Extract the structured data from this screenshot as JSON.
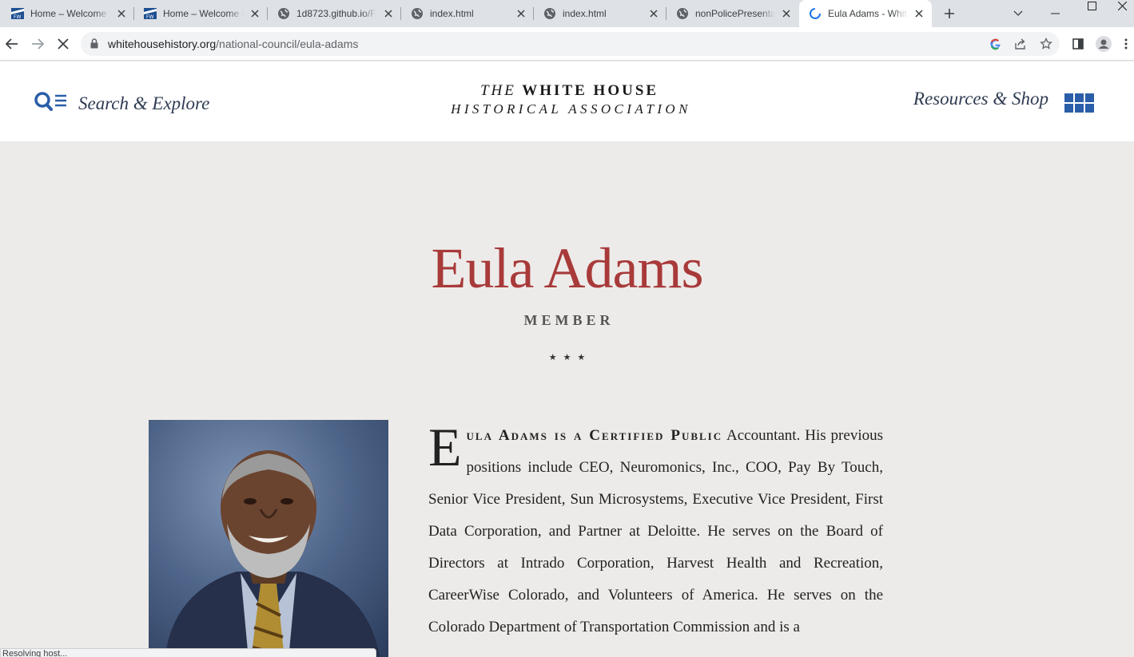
{
  "browser": {
    "tabs": [
      {
        "title": "Home – Welcome to",
        "favicon": "fw-favicon"
      },
      {
        "title": "Home – Welcome to",
        "favicon": "fw-favicon"
      },
      {
        "title": "1d8723.github.io/FP",
        "favicon": "globe-icon"
      },
      {
        "title": "index.html",
        "favicon": "globe-icon"
      },
      {
        "title": "index.html",
        "favicon": "globe-icon"
      },
      {
        "title": "nonPolicePresentat",
        "favicon": "globe-icon"
      },
      {
        "title": "Eula Adams - White",
        "favicon": "loading-favicon",
        "active": true
      }
    ],
    "url_host": "whitehousehistory.org",
    "url_path": "/national-council/eula-adams",
    "status_text": "Resolving host..."
  },
  "header": {
    "search_label": "Search & Explore",
    "logo_line1_the": "THE",
    "logo_line1_rest": "WHITE HOUSE",
    "logo_line2": "HISTORICAL ASSOCIATION",
    "resources_label": "Resources & Shop"
  },
  "profile": {
    "name": "Eula Adams",
    "role": "MEMBER",
    "divider": "★★★",
    "bio_dropcap": "E",
    "bio_lead": "ula Adams is a Certified Public",
    "bio_rest": "Accountant. His previous positions include CEO, Neuromonics, Inc., COO, Pay By Touch, Senior Vice President, Sun Microsystems, Executive Vice President, First Data Corporation, and Partner at Deloitte. He serves on the Board of Directors at Intrado Corporation, Harvest Health and Recreation, CareerWise Colorado, and Volunteers of America. He serves on the Colorado Department of Transportation Commission and is a"
  },
  "colors": {
    "accent_red": "#a83a3a",
    "brand_blue": "#2a5ea8",
    "page_bg": "#edebe9"
  }
}
